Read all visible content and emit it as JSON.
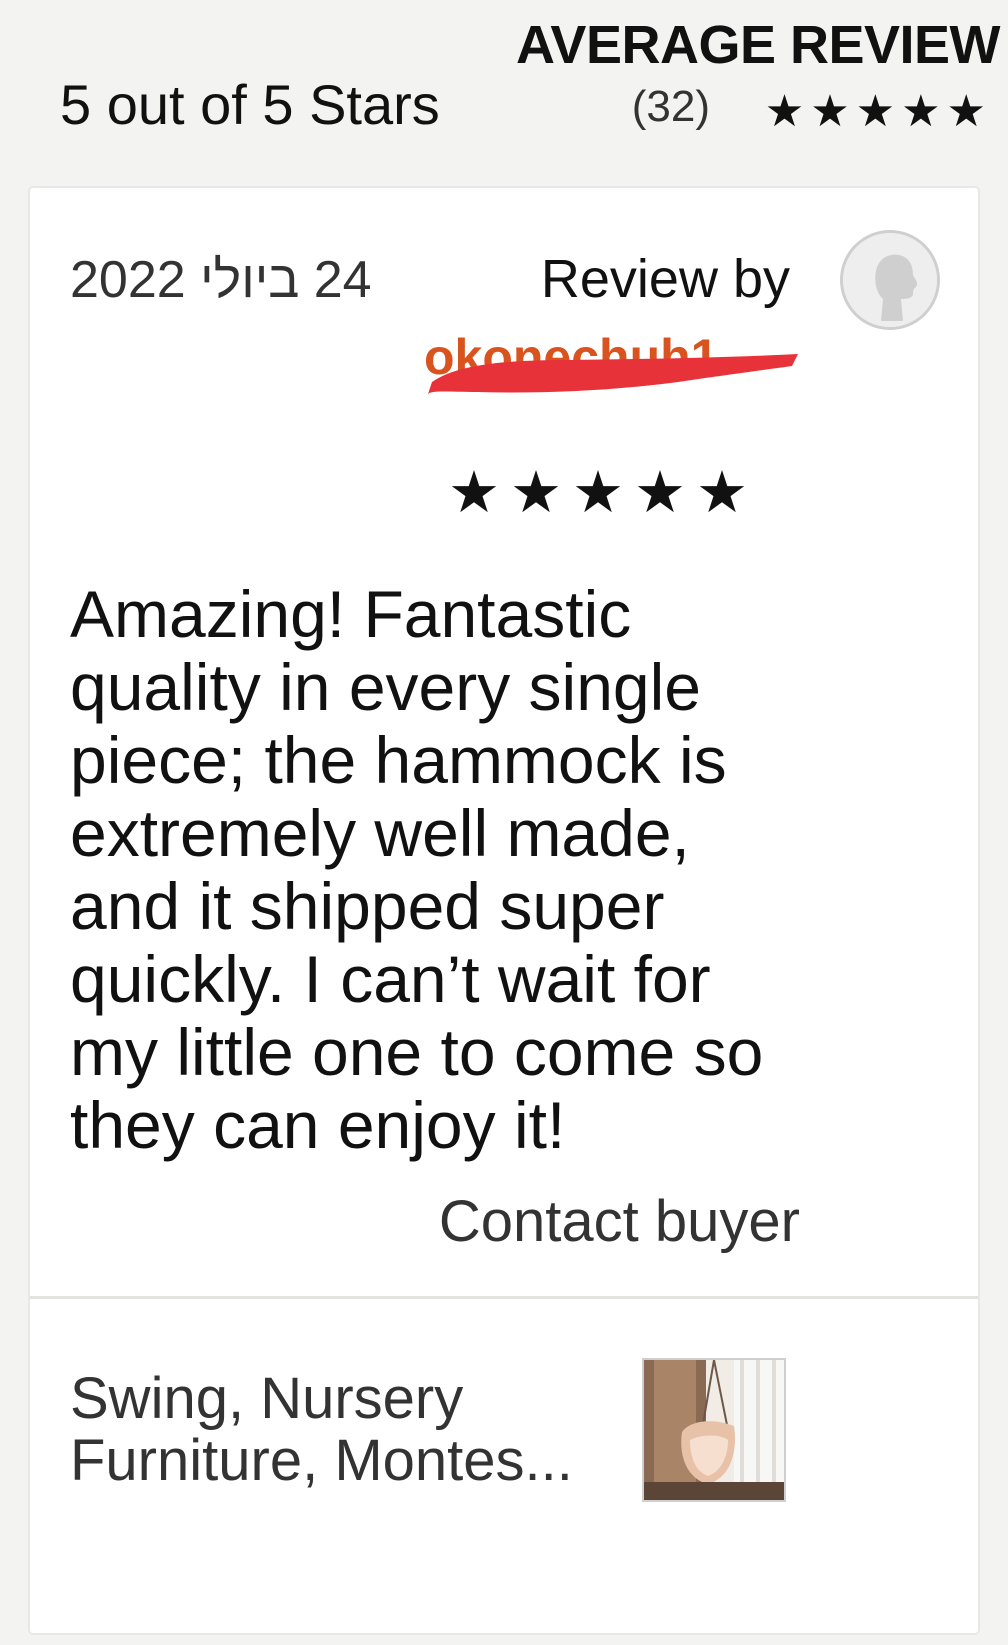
{
  "header": {
    "title": "AVERAGE REVIEW",
    "rating_text": "5 out of 5 Stars",
    "review_count": "(32)",
    "stars": "★★★★★",
    "rating_value": 5,
    "rating_max": 5
  },
  "review": {
    "date": "24 ביולי 2022",
    "review_by_label": "Review by",
    "reviewer_name": "okonechuh1",
    "stars": "★★★★★",
    "rating_value": 5,
    "text": "Amazing! Fantastic quality in every single piece; the hammock is extremely well made, and it shipped super quickly. I can’t wait for my little one to come so they can enjoy it!",
    "contact_label": "Contact buyer",
    "avatar_icon": "default-user-avatar-icon",
    "redaction_color": "#e8323a"
  },
  "product": {
    "name": "Swing, Nursery Furniture, Montes...",
    "thumbnail_icon": "product-thumbnail-image"
  }
}
